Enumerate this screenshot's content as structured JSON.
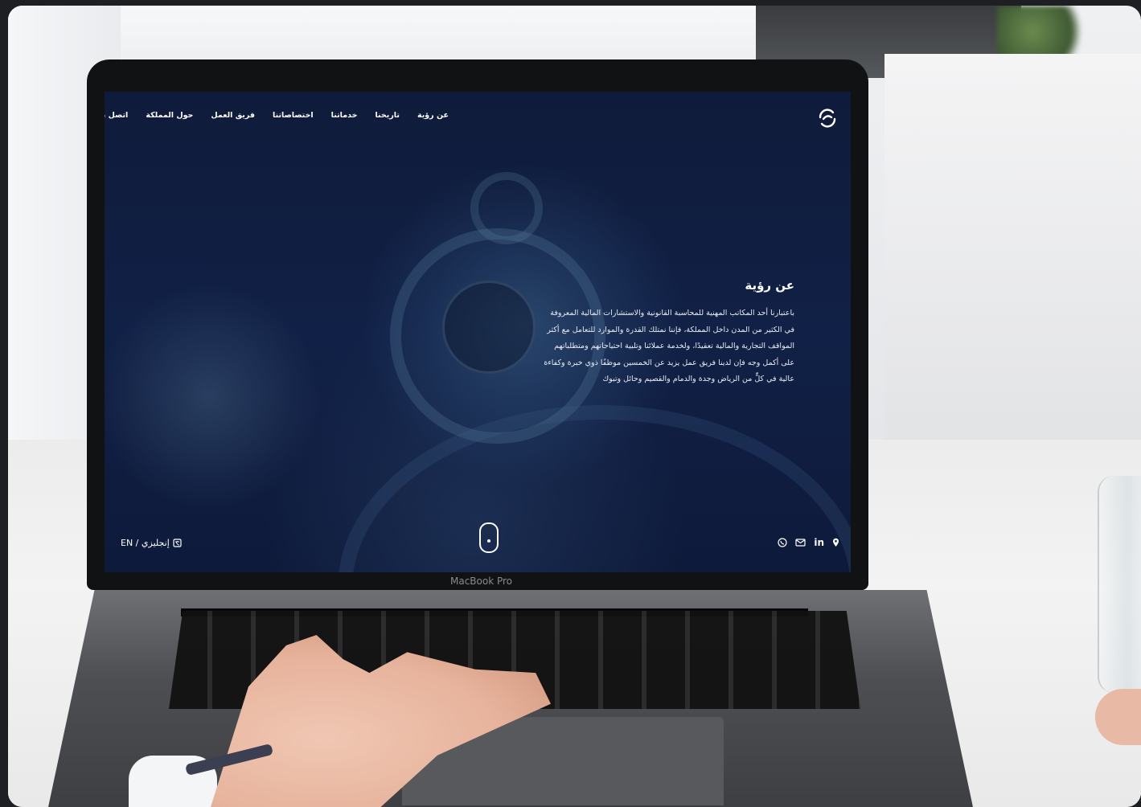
{
  "nav": {
    "links": [
      "عن رؤية",
      "تاريخنا",
      "خدماتنا",
      "اختصاصاتنا",
      "فريق العمل",
      "حول المملكة",
      "اتصل بنا"
    ]
  },
  "about": {
    "title": "عن رؤية",
    "lines": [
      "باعتبارنا أحد المكاتب المهنية للمحاسبة القانونية والاستشارات المالية المعروفة",
      "في الكثير من المدن داخل المملكة، فإننا نمتلك القدرة والموارد للتعامل مع أكثر",
      "المواقف التجارية والمالية تعقيدًا، ولخدمة عملائنا وتلبية احتياجاتهم ومتطلباتهم",
      "على أكمل وجه فإن لدينا فريق عمل يزيد عن الخمسين موظفًا ذوي خبرة وكفاءة",
      "عالية في كلٍّ من الرياض وجدة والدمام والقصيم وحائل وتبوك"
    ]
  },
  "footer": {
    "lang_label": "EN / إنجليزي",
    "lang_icon": "translate-icon",
    "social_icons": [
      "location-icon",
      "linkedin-icon",
      "mail-icon",
      "whatsapp-icon"
    ],
    "linkedin_text": "in"
  },
  "device": {
    "brand": "MacBook Pro"
  },
  "colors": {
    "screen_bg": "#0f1b3a",
    "text": "#ffffff"
  }
}
